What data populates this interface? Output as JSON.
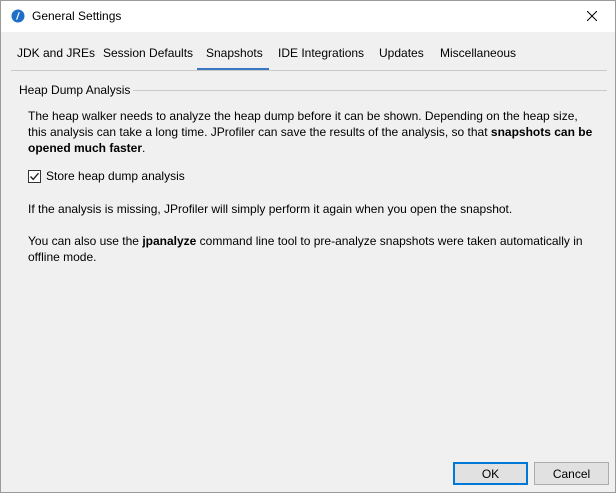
{
  "window": {
    "title": "General Settings"
  },
  "tabs": [
    {
      "label": "JDK and JREs"
    },
    {
      "label": "Session Defaults"
    },
    {
      "label": "Snapshots"
    },
    {
      "label": "IDE Integrations"
    },
    {
      "label": "Updates"
    },
    {
      "label": "Miscellaneous"
    }
  ],
  "active_tab": "Snapshots",
  "section": {
    "title": "Heap Dump Analysis",
    "para1_text": "The heap walker needs to analyze the heap dump before it can be shown. Depending on the heap size, this analysis can take a long time. JProfiler can save the results of the analysis, so that ",
    "para1_bold": "snapshots can be opened much faster",
    "para1_end": ".",
    "checkbox_label": "Store heap dump analysis",
    "checkbox_checked": true,
    "para2": "If the analysis is missing, JProfiler will simply perform it again when you open the snapshot.",
    "para3_start": "You can also use the ",
    "para3_bold": "jpanalyze",
    "para3_end": " command line tool to pre-analyze snapshots were taken automatically in offline mode."
  },
  "buttons": {
    "ok": "OK",
    "cancel": "Cancel"
  },
  "colors": {
    "accent": "#3b78c4",
    "primary_border": "#0078d7"
  }
}
